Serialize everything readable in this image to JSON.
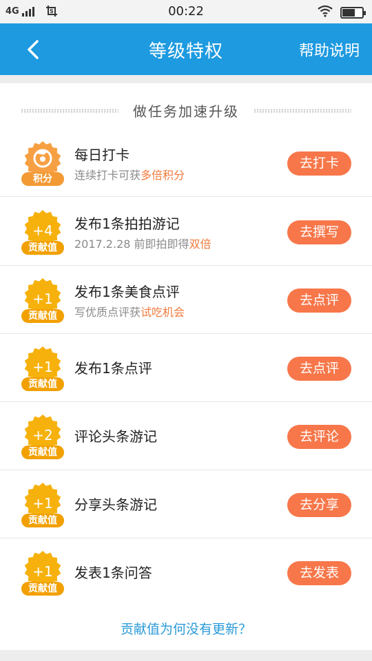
{
  "status_bar": {
    "network": "4G",
    "time": "00:22",
    "icons": [
      "signal-icon",
      "screenshot-icon",
      "wifi-icon",
      "battery-charging-icon"
    ]
  },
  "nav": {
    "back_icon": "chevron-left-icon",
    "title": "等级特权",
    "help": "帮助说明",
    "color": "#1d9ae0"
  },
  "section": {
    "title": "做任务加速升级"
  },
  "tasks": [
    {
      "badge_icon": "logo-icon",
      "badge_tag": "积分",
      "title": "每日打卡",
      "sub_prefix": "连续打卡可获",
      "sub_highlight": "多倍积分",
      "button": "去打卡"
    },
    {
      "badge_value": "+4",
      "badge_tag": "贡献值",
      "title": "发布1条拍拍游记",
      "sub_prefix": "2017.2.28 前即拍即得",
      "sub_highlight": "双倍",
      "button": "去撰写"
    },
    {
      "badge_value": "+1",
      "badge_tag": "贡献值",
      "title": "发布1条美食点评",
      "sub_prefix": "写优质点评获",
      "sub_highlight": "试吃机会",
      "button": "去点评"
    },
    {
      "badge_value": "+1",
      "badge_tag": "贡献值",
      "title": "发布1条点评",
      "button": "去点评"
    },
    {
      "badge_value": "+2",
      "badge_tag": "贡献值",
      "title": "评论头条游记",
      "button": "去评论"
    },
    {
      "badge_value": "+1",
      "badge_tag": "贡献值",
      "title": "分享头条游记",
      "button": "去分享"
    },
    {
      "badge_value": "+1",
      "badge_tag": "贡献值",
      "title": "发表1条问答",
      "button": "去发表"
    }
  ],
  "footer_link": "贡献值为何没有更新？",
  "colors": {
    "accent": "#1d9ae0",
    "button": "#f7774a",
    "badge": "#f6b10c",
    "highlight": "#f07a3c",
    "link": "#2a9ad8"
  }
}
